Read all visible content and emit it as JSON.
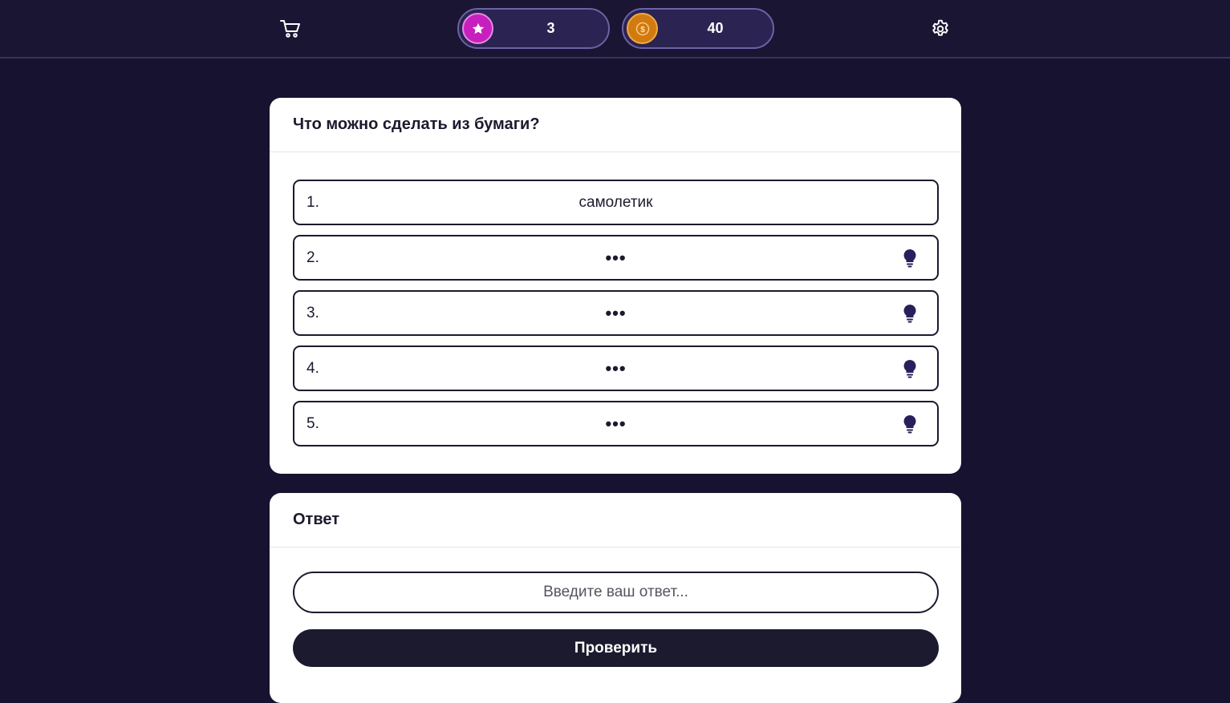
{
  "header": {
    "cart_icon": "cart-icon",
    "settings_icon": "gear-icon",
    "stars": {
      "icon": "star-icon",
      "value": "3",
      "color": "#c81fbf"
    },
    "coins": {
      "icon": "coin-icon",
      "value": "40",
      "color": "#d27a12"
    }
  },
  "question": {
    "title": "Что можно сделать из бумаги?",
    "answers": [
      {
        "num": "1.",
        "text": "самолетик",
        "revealed": true
      },
      {
        "num": "2.",
        "text": "•••",
        "revealed": false,
        "hint_icon": "lightbulb-icon"
      },
      {
        "num": "3.",
        "text": "•••",
        "revealed": false,
        "hint_icon": "lightbulb-icon"
      },
      {
        "num": "4.",
        "text": "•••",
        "revealed": false,
        "hint_icon": "lightbulb-icon"
      },
      {
        "num": "5.",
        "text": "•••",
        "revealed": false,
        "hint_icon": "lightbulb-icon"
      }
    ]
  },
  "answer": {
    "title": "Ответ",
    "placeholder": "Введите ваш ответ...",
    "submit_label": "Проверить"
  },
  "colors": {
    "background": "#171230",
    "accent_dark": "#1b1a2e",
    "pill_border": "#6c62a6",
    "hint_icon": "#2a1f5c"
  }
}
